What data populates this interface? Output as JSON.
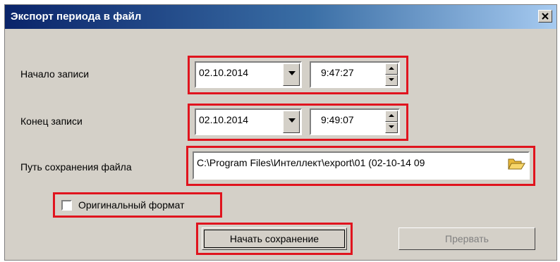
{
  "window": {
    "title": "Экспорт периода в файл",
    "close_glyph": "✕"
  },
  "start": {
    "label": "Начало записи",
    "date": "02.10.2014",
    "time": "9:47:27"
  },
  "end": {
    "label": "Конец записи",
    "date": "02.10.2014",
    "time": "9:49:07"
  },
  "path": {
    "label": "Путь сохранения файла",
    "value": "C:\\Program Files\\Интеллект\\export\\01  (02-10-14 09",
    "icon": "folder-open-icon"
  },
  "original_format": {
    "label": "Оригинальный формат",
    "checked": false
  },
  "buttons": {
    "start_save": "Начать сохранение",
    "abort": "Прервать"
  },
  "colors": {
    "highlight": "#e0141e",
    "dialog_bg": "#d4d0c8",
    "title_start": "#0a246a",
    "title_end": "#a6caf0"
  }
}
